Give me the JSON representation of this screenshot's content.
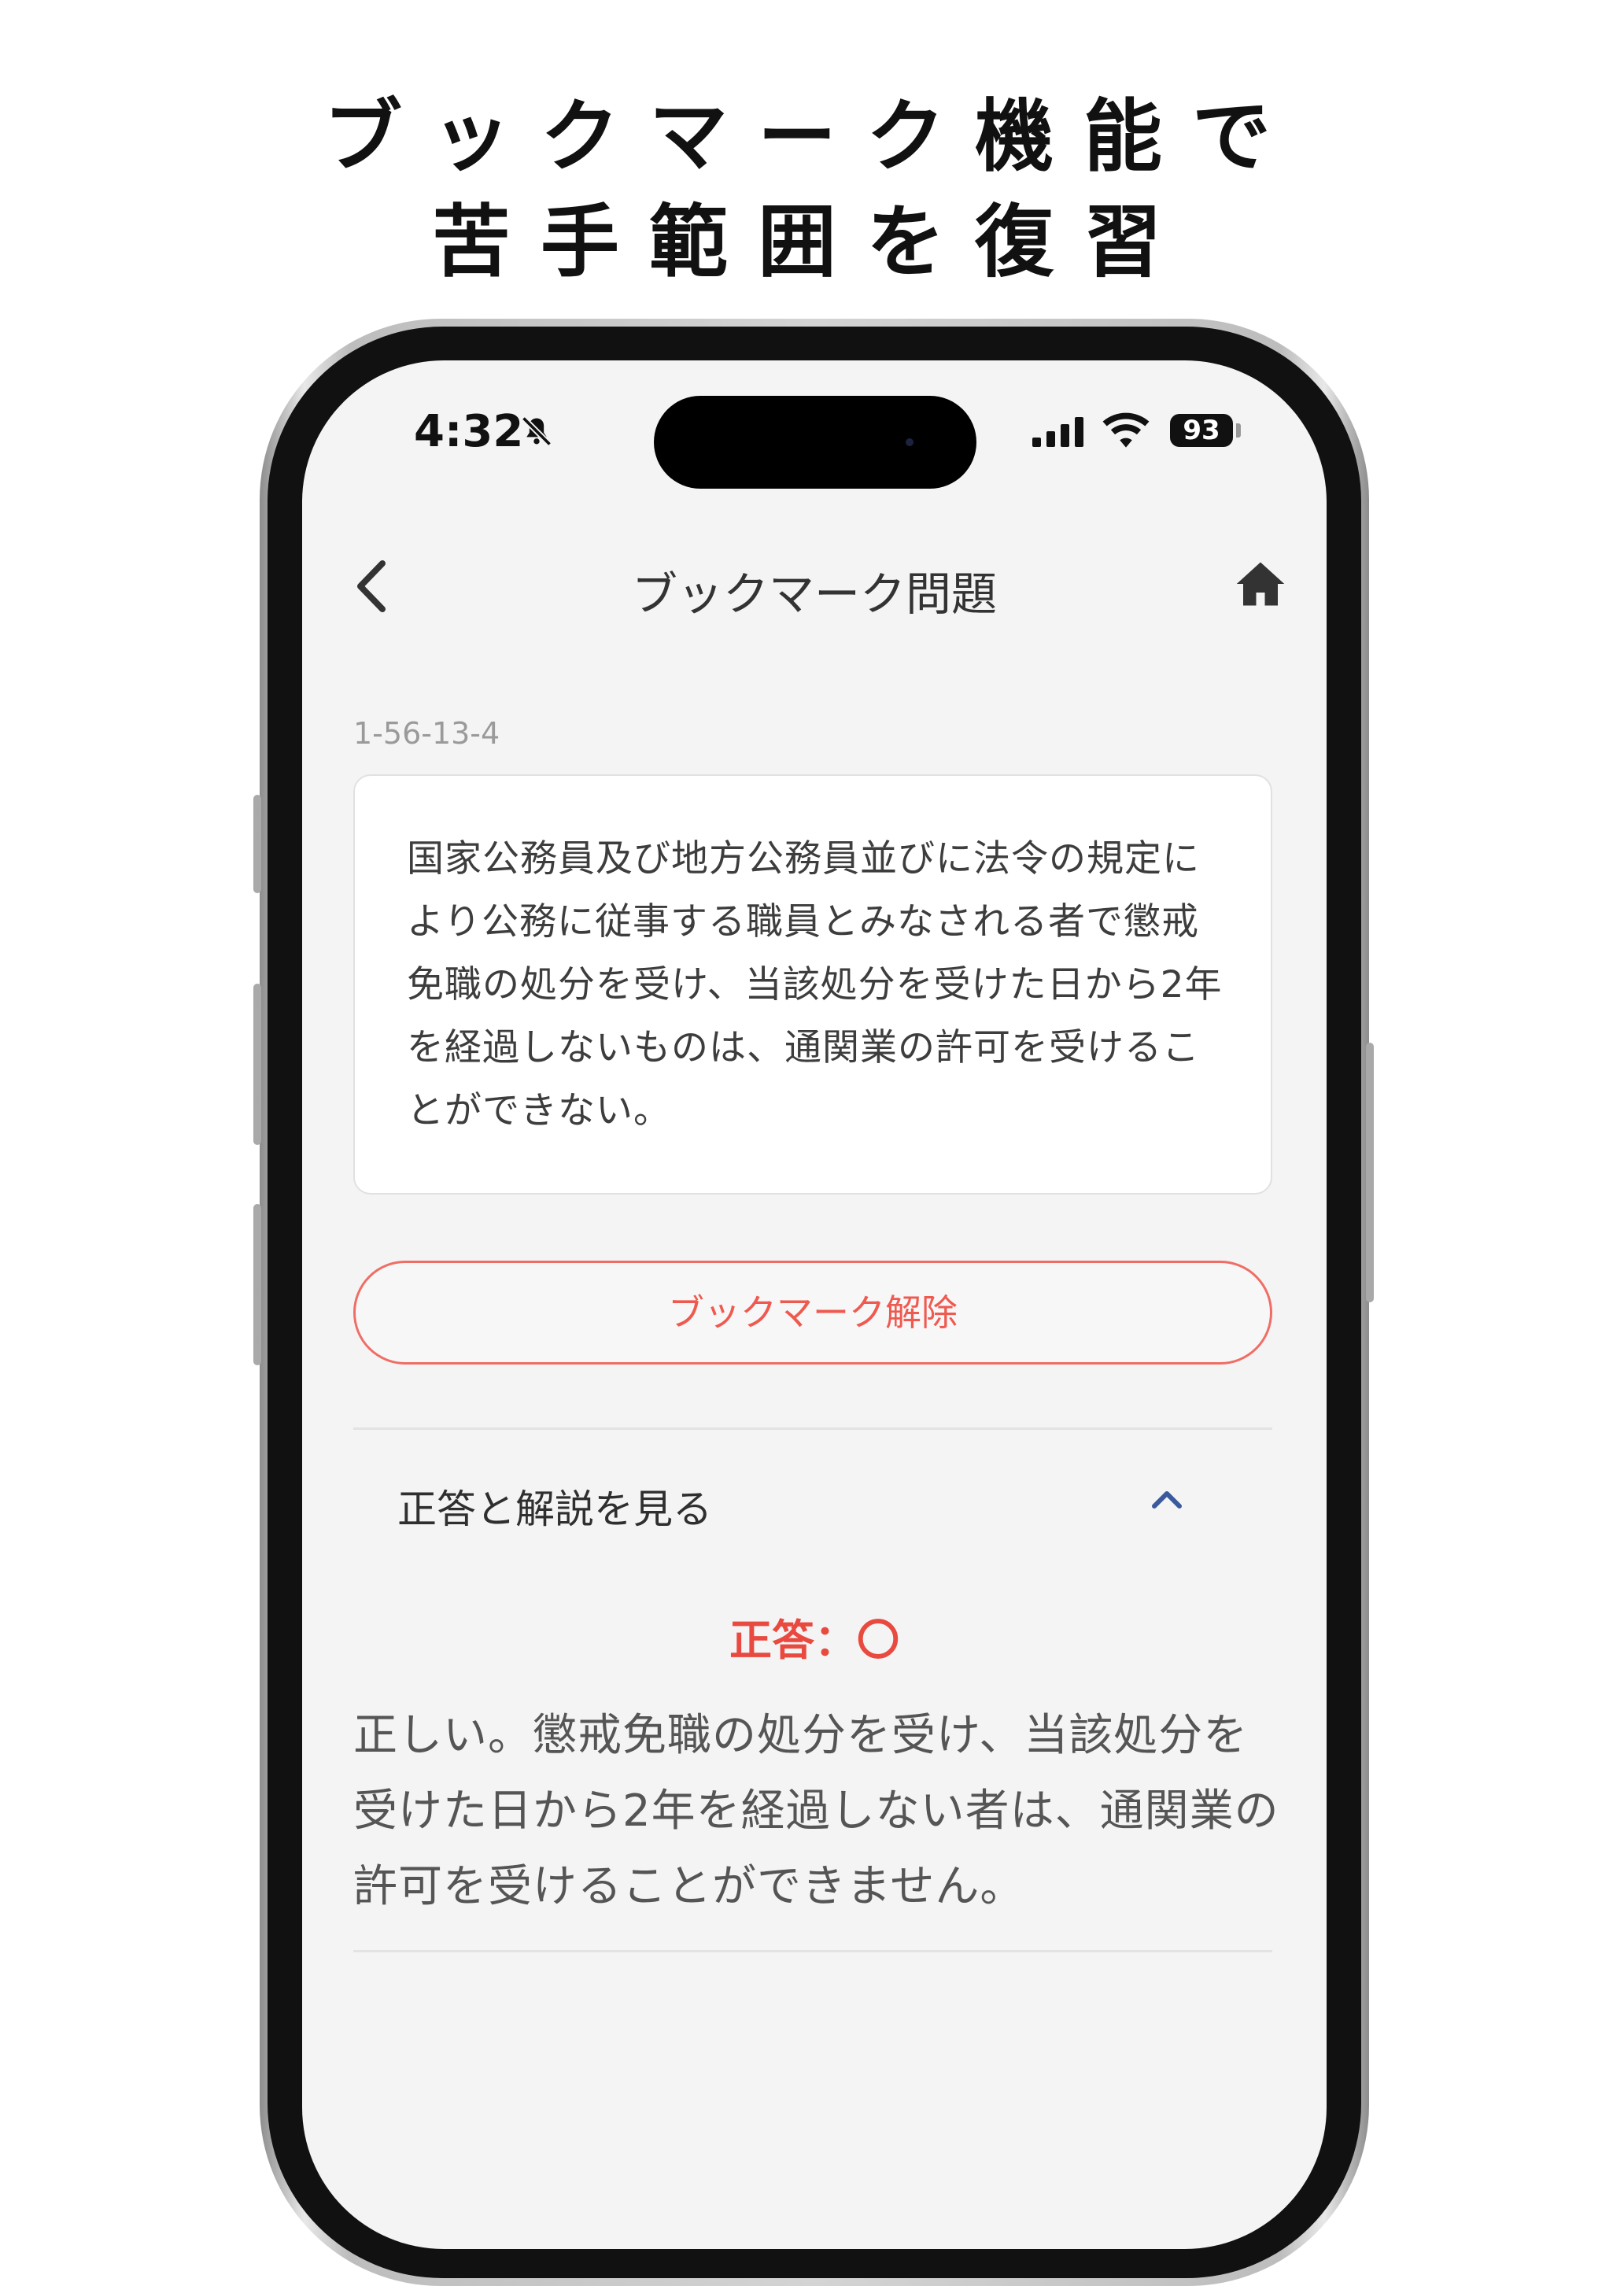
{
  "promo": {
    "line1": "ブックマーク機能で",
    "line2": "苦手範囲を復習"
  },
  "status_bar": {
    "time": "4:32",
    "battery": "93",
    "icons": [
      "bell-slash-icon",
      "signal-icon",
      "wifi-icon",
      "battery-icon"
    ]
  },
  "nav": {
    "title": "ブックマーク問題",
    "back_icon": "chevron-left-icon",
    "home_icon": "home-icon"
  },
  "question": {
    "id": "1-56-13-4",
    "text": "国家公務員及び地方公務員並びに法令の規定により公務に従事する職員とみなされる者で懲戒免職の処分を受け、当該処分を受けた日から2年を経過しないものは、通関業の許可を受けることができない。"
  },
  "bookmark_button": "ブックマーク解除",
  "answer_section": {
    "toggle_label": "正答と解説を見る",
    "answer": "正答：〇",
    "explanation": "正しい。懲戒免職の処分を受け、当該処分を受けた日から2年を経過しない者は、通関業の許可を受けることができません。"
  },
  "colors": {
    "accent_red": "#ef5a50",
    "chevron_blue": "#3a5a9c",
    "screen_bg": "#f4f4f4"
  }
}
